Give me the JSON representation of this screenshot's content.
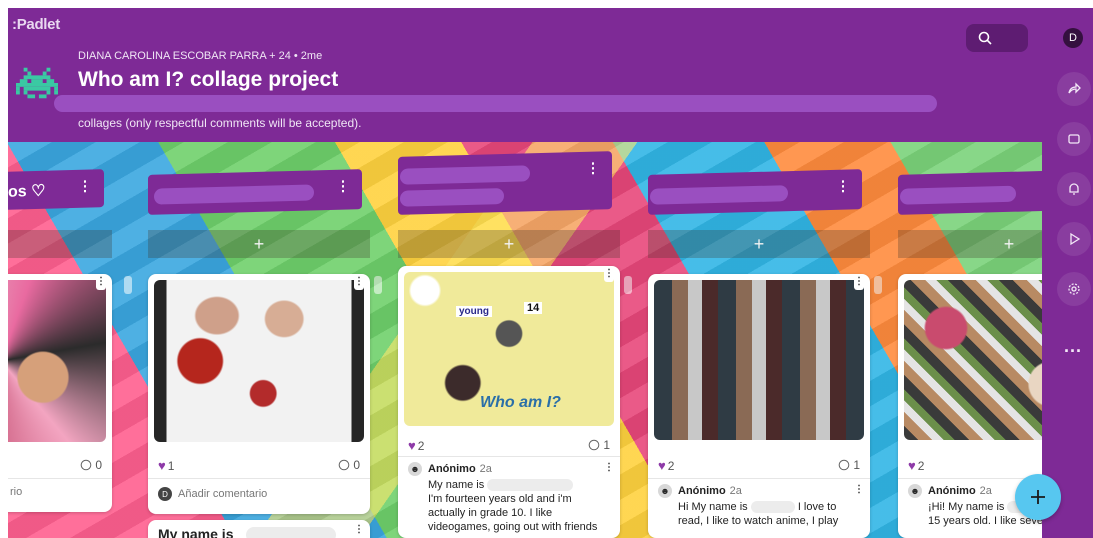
{
  "app": {
    "logo": ":Padlet"
  },
  "header": {
    "attribution": "DIANA CAROLINA ESCOBAR PARRA + 24 •  2me",
    "title": "Who am I? collage project",
    "description": "collages (only respectful comments will be accepted)."
  },
  "search": {
    "icon": "search-icon"
  },
  "user": {
    "initial": "D"
  },
  "rail": {
    "more": "..."
  },
  "columns": [
    {
      "title": "os ♡"
    },
    {
      "title": ""
    },
    {
      "title": ""
    },
    {
      "title": ""
    },
    {
      "title": ""
    }
  ],
  "add_symbol": "+",
  "cards": [
    {
      "comments": "0",
      "footer_text": "rio"
    },
    {
      "likes": "1",
      "comments": "0",
      "add_comment": "Añadir comentario",
      "avatar": "D",
      "next_post_title": "My name is"
    },
    {
      "likes": "2",
      "comments": "1",
      "author": "Anónimo",
      "ago": "2a",
      "text1": "My name is",
      "text2": "I'm fourteen years old and i'm",
      "text3": "actually in grade 10. I like",
      "text4": "videogames, going out with friends"
    },
    {
      "likes": "2",
      "comments": "1",
      "author": "Anónimo",
      "ago": "2a",
      "text1a": "Hi My name is",
      "text1b": "I love to",
      "text2": "read, I like to watch anime, I play"
    },
    {
      "likes": "2",
      "author": "Anónimo",
      "ago": "2a",
      "text1": "¡Hi! My name is",
      "text2": "15 years old. I like seve"
    }
  ],
  "collage_text": {
    "word_young": "young",
    "word_whoami": "Who am I?",
    "number": "14"
  },
  "colors": {
    "header": "#7e2a96",
    "accent_heart": "#8e3aa8",
    "fab": "#57c7f0"
  }
}
